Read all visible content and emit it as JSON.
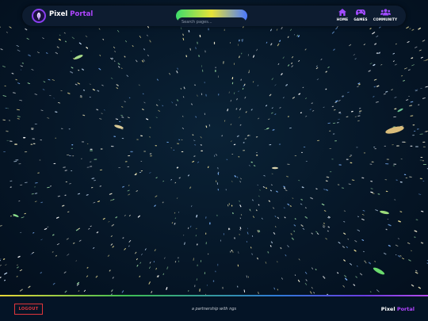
{
  "brand": {
    "part1": "Pixel",
    "part2": "Portal"
  },
  "search": {
    "placeholder": "Search pages..."
  },
  "nav": {
    "items": [
      {
        "label": "HOME",
        "icon": "home-icon"
      },
      {
        "label": "GAMES",
        "icon": "gamepad-icon"
      },
      {
        "label": "COMMUNITY",
        "icon": "users-icon"
      }
    ]
  },
  "footer": {
    "logout_label": "LOGOUT",
    "tagline": "a partnership with ngs",
    "brand_part1": "Pixel",
    "brand_part2": "Portal"
  },
  "colors": {
    "accent_purple": "#b045ff",
    "logout_red": "#e0353b",
    "background": "#041426"
  }
}
